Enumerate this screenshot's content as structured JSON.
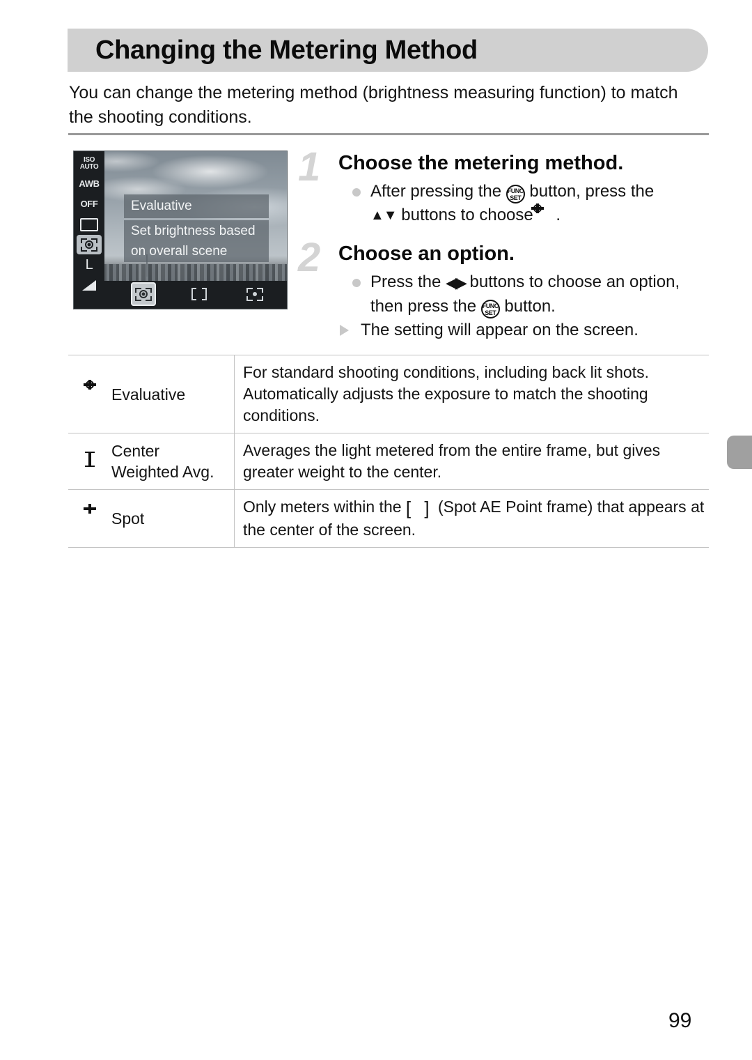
{
  "page": {
    "number": "99"
  },
  "header": {
    "title": "Changing the Metering Method"
  },
  "intro": {
    "text": "You can change the metering method (brightness measuring function) to match the shooting conditions."
  },
  "lcd": {
    "osd_left_icons": [
      {
        "name": "iso-auto-icon",
        "label_top": "ISO",
        "label_bottom": "AUTO"
      },
      {
        "name": "awb-icon",
        "label": "AWB"
      },
      {
        "name": "flash-off-icon",
        "label": "OFF"
      },
      {
        "name": "drive-mode-icon",
        "label": ""
      },
      {
        "name": "metering-evaluative-icon",
        "label": ""
      },
      {
        "name": "image-size-large-icon",
        "label": "L"
      },
      {
        "name": "compression-fine-icon",
        "label": ""
      }
    ],
    "popup_title": "Evaluative",
    "popup_body_line1": "Set brightness based",
    "popup_body_line2": "on overall scene",
    "options": [
      {
        "name": "option-evaluative",
        "selected": true
      },
      {
        "name": "option-center-weighted",
        "selected": false
      },
      {
        "name": "option-spot",
        "selected": false
      }
    ]
  },
  "steps": [
    {
      "number": "1",
      "heading": "Choose the metering method.",
      "lines": [
        {
          "marker": "dot",
          "parts": [
            {
              "type": "text",
              "value": "After pressing the "
            },
            {
              "type": "icon",
              "name": "func-set-icon",
              "top": "FUNC.",
              "bottom": "SET"
            },
            {
              "type": "text",
              "value": " button, press the"
            }
          ]
        },
        {
          "marker": "none",
          "parts": [
            {
              "type": "icon",
              "name": "up-down-arrows-icon",
              "value": "▲▼"
            },
            {
              "type": "text",
              "value": " buttons to choose "
            },
            {
              "type": "icon",
              "name": "metering-evaluative-icon"
            },
            {
              "type": "text",
              "value": "."
            }
          ]
        }
      ]
    },
    {
      "number": "2",
      "heading": "Choose an option.",
      "lines": [
        {
          "marker": "dot",
          "parts": [
            {
              "type": "text",
              "value": "Press the "
            },
            {
              "type": "icon",
              "name": "left-right-arrows-icon",
              "value": "◀▶"
            },
            {
              "type": "text",
              "value": " buttons to choose an option,"
            }
          ]
        },
        {
          "marker": "none",
          "parts": [
            {
              "type": "text",
              "value": "then press the "
            },
            {
              "type": "icon",
              "name": "func-set-icon",
              "top": "FUNC.",
              "bottom": "SET"
            },
            {
              "type": "text",
              "value": " button."
            }
          ]
        },
        {
          "marker": "triangle",
          "parts": [
            {
              "type": "text",
              "value": "The setting will appear on the screen."
            }
          ]
        }
      ]
    }
  ],
  "table": {
    "rows": [
      {
        "icon_name": "metering-evaluative-icon",
        "name": "Evaluative",
        "description": "For standard shooting conditions, including back lit shots. Automatically adjusts the exposure to match the shooting conditions."
      },
      {
        "icon_name": "metering-center-weighted-icon",
        "name": "Center Weighted Avg.",
        "description_pre": "Averages the light metered from the entire frame, but gives greater weight to the center.",
        "description": "Averages the light metered from the entire frame, but gives greater weight to the center."
      },
      {
        "icon_name": "metering-spot-icon",
        "name": "Spot",
        "description_pre": "Only meters within the ",
        "description_post": " (Spot AE Point frame) that appears at the center of the screen.",
        "description": "Only meters within the [ ] (Spot AE Point frame) that appears at the center of the screen."
      }
    ]
  },
  "glyphs": {
    "func_set_top": "FUNC.",
    "func_set_bottom": "SET",
    "up_down": "▲▼",
    "left_right": "◀▶",
    "empty_bracket": "[  ]"
  },
  "colors": {
    "header_band": "#d0d0d0",
    "rule": "#999999",
    "table_border": "#c2c2c2",
    "step_number": "#d4d4d4",
    "bullet": "#c8c8c8",
    "edge_tab": "#a0a0a0"
  }
}
